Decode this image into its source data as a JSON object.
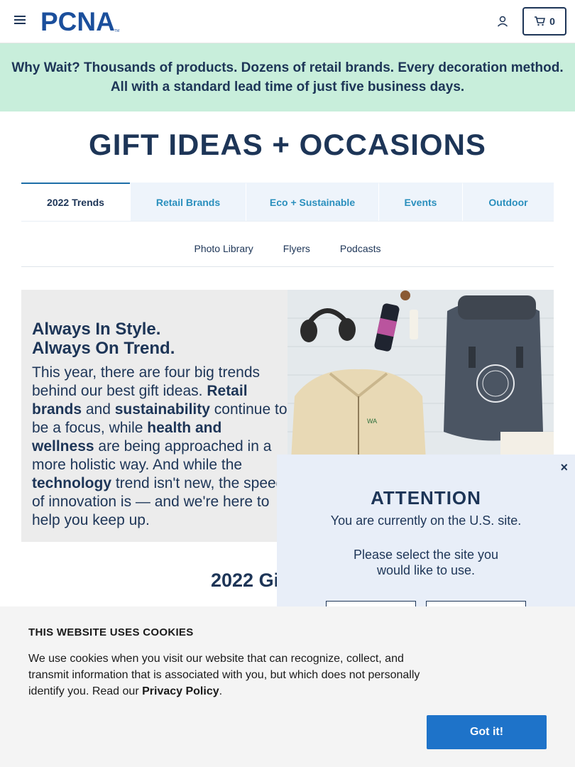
{
  "header": {
    "logo_text": "PCNA",
    "logo_tm": "TM",
    "cart_count": "0"
  },
  "promo": {
    "text": "Why Wait? Thousands of products. Dozens of retail brands. Every decoration method. All with a standard lead time of just five business days."
  },
  "page_title": "GIFT IDEAS + OCCASIONS",
  "tabs": [
    {
      "label": "2022 Trends",
      "active": true
    },
    {
      "label": "Retail Brands",
      "active": false
    },
    {
      "label": "Eco + Sustainable",
      "active": false
    },
    {
      "label": "Events",
      "active": false
    },
    {
      "label": "Outdoor",
      "active": false
    }
  ],
  "subnav": [
    {
      "label": "Photo Library"
    },
    {
      "label": "Flyers"
    },
    {
      "label": "Podcasts"
    }
  ],
  "hero": {
    "heading_line1": "Always In Style.",
    "heading_line2": "Always On Trend.",
    "p1": "This year, there are four big trends behind our best gift ideas. ",
    "b1": "Retail brands",
    "p2": " and ",
    "b2": "sustainability",
    "p3": " continue to be a focus, while ",
    "b3": "health and wellness",
    "p4": " are being approached in a more holistic way. And while the ",
    "b4": "technology",
    "p5": " trend isn't new, the speed of innovation is — and we're here to help you keep up.",
    "bag_label": "WA"
  },
  "section_title": "2022 Gi",
  "attention": {
    "close": "×",
    "title": "ATTENTION",
    "line1": "You are currently on the U.S. site.",
    "line2": "Please select the site you would like to use."
  },
  "cookie": {
    "title": "THIS WEBSITE USES COOKIES",
    "text": "We use cookies when you visit our website that can recognize, collect, and transmit information that is associated with you, but which does not personally identify you. Read our ",
    "link": "Privacy Policy",
    "end": ".",
    "button": "Got it!"
  },
  "colors": {
    "navy": "#1d3557",
    "promo_bg": "#c8eedb",
    "tab_link": "#2a8fbd",
    "button_blue": "#1e73c9"
  }
}
